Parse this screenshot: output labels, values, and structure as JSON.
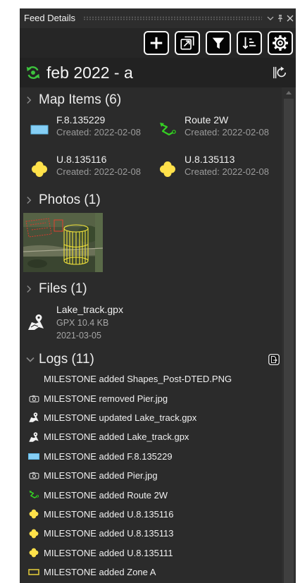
{
  "window": {
    "title": "Feed Details"
  },
  "header_controls": [
    {
      "icon": "chevron-down-icon"
    },
    {
      "icon": "pin-icon"
    },
    {
      "icon": "close-icon"
    }
  ],
  "toolbar": {
    "buttons": [
      {
        "icon": "plus-icon"
      },
      {
        "icon": "open-external-icon"
      },
      {
        "icon": "filter-icon"
      },
      {
        "icon": "sort-icon"
      },
      {
        "icon": "gear-icon"
      }
    ]
  },
  "feed": {
    "name": "feb 2022 - a",
    "status_icon": "sync-icon",
    "action_icon": "split-sync-icon"
  },
  "map_items": {
    "label": "Map Items (6)",
    "chevron": "chevron-right-icon",
    "items": [
      {
        "name": "F.8.135229",
        "created": "Created: 2022-02-08",
        "icon": "rectangle-shape-icon"
      },
      {
        "name": "Route 2W",
        "created": "Created: 2022-02-08",
        "icon": "route-icon"
      },
      {
        "name": "U.8.135116",
        "created": "Created: 2022-02-08",
        "icon": "point-marker-icon"
      },
      {
        "name": "U.8.135113",
        "created": "Created: 2022-02-08",
        "icon": "point-marker-icon"
      }
    ]
  },
  "photos": {
    "label": "Photos (1)",
    "chevron": "chevron-right-icon",
    "items": [
      {
        "icon": "satellite-photo-thumbnail"
      }
    ]
  },
  "files": {
    "label": "Files (1)",
    "chevron": "chevron-right-icon",
    "items": [
      {
        "name": "Lake_track.gpx",
        "size": "GPX 10.4 KB",
        "date": "2021-03-05",
        "icon": "gpx-file-icon"
      }
    ]
  },
  "logs": {
    "label": "Logs (11)",
    "chevron": "chevron-down-icon",
    "export_icon": "export-log-icon",
    "entries": [
      {
        "text": "MILESTONE added Shapes_Post-DTED.PNG"
      },
      {
        "text": "MILESTONE removed Pier.jpg",
        "icon": "camera-icon"
      },
      {
        "text": "MILESTONE updated Lake_track.gpx",
        "icon": "gpx-file-icon"
      },
      {
        "text": "MILESTONE added Lake_track.gpx",
        "icon": "gpx-file-icon"
      },
      {
        "text": "MILESTONE added F.8.135229",
        "icon": "rectangle-shape-icon"
      },
      {
        "text": "MILESTONE added Pier.jpg",
        "icon": "camera-icon"
      },
      {
        "text": "MILESTONE added Route 2W",
        "icon": "route-icon"
      },
      {
        "text": "MILESTONE added U.8.135116",
        "icon": "point-marker-icon"
      },
      {
        "text": "MILESTONE added U.8.135113",
        "icon": "point-marker-icon"
      },
      {
        "text": "MILESTONE added U.8.135111",
        "icon": "point-marker-icon"
      },
      {
        "text": "MILESTONE added Zone A",
        "icon": "zone-outline-icon"
      }
    ]
  },
  "colors": {
    "panel_background": "#2b2b2b",
    "accent_green": "#3ec43e",
    "shape_blue": "#86cff5",
    "marker_yellow": "#ffe14a",
    "route_green": "#35d023",
    "zone_yellow": "#e8cf3a",
    "text_primary": "#f0f0f0",
    "text_secondary": "#9b9b9b"
  }
}
